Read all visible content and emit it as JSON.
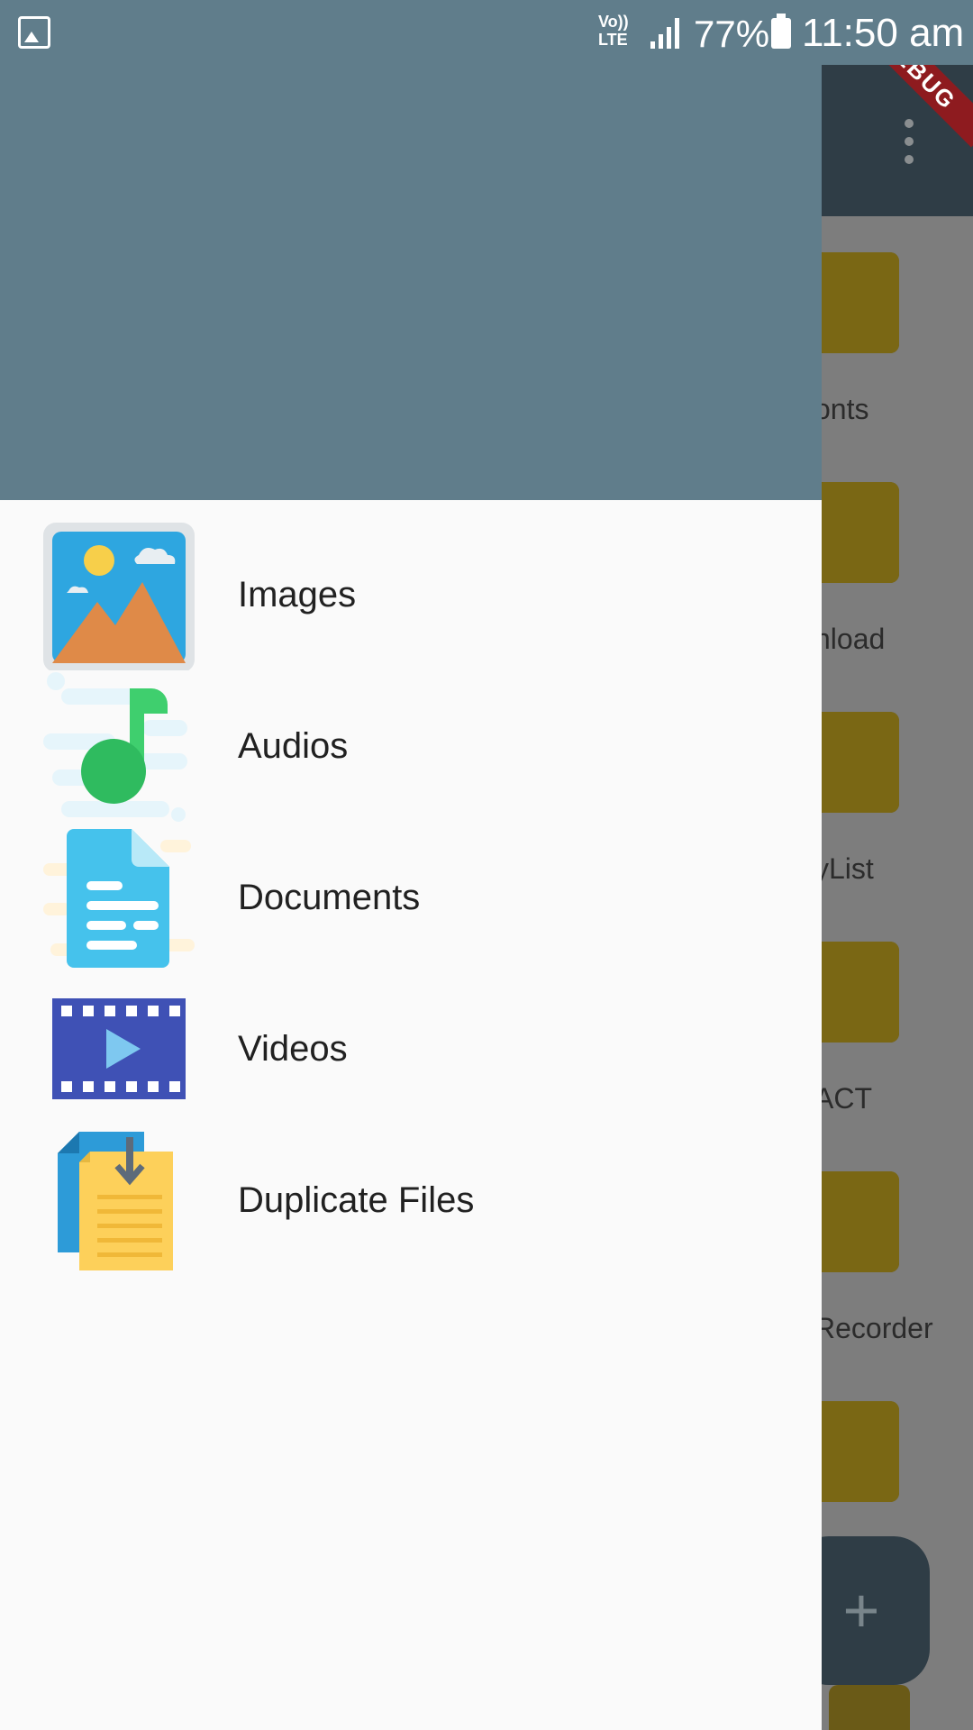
{
  "status_bar": {
    "volte": "Vo))\nLTE",
    "battery": "77%",
    "time": "11:50 am"
  },
  "debug_banner": "DEBUG",
  "drawer": {
    "items": [
      {
        "label": "Images",
        "icon": "image-gallery-icon"
      },
      {
        "label": "Audios",
        "icon": "music-note-icon"
      },
      {
        "label": "Documents",
        "icon": "document-icon"
      },
      {
        "label": "Videos",
        "icon": "film-strip-icon"
      },
      {
        "label": "Duplicate Files",
        "icon": "duplicate-files-icon"
      }
    ]
  },
  "background_folders": [
    {
      "label": "onts"
    },
    {
      "label": "nload"
    },
    {
      "label": "yList"
    },
    {
      "label": "ACT"
    },
    {
      "label": "Recorder"
    },
    {
      "label": ""
    }
  ],
  "fab": {
    "icon": "plus-icon"
  },
  "colors": {
    "header": "#607d8b",
    "app_bar": "#2f3d46",
    "drawer_bg": "#fafafa",
    "debug": "#8e1b1f"
  }
}
